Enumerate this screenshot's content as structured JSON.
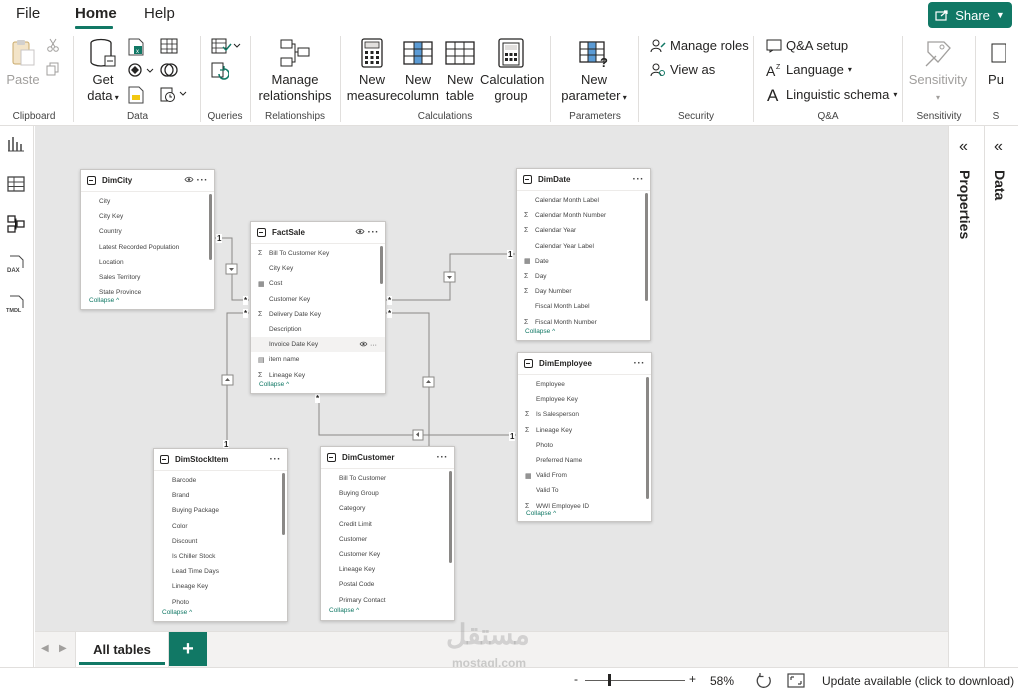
{
  "menu": {
    "file": "File",
    "home": "Home",
    "help": "Help",
    "share": "Share"
  },
  "ribbon": {
    "paste": "Paste",
    "get_data": "Get",
    "get_data2": "data",
    "manage_rel": "Manage",
    "manage_rel2": "relationships",
    "new_measure": "New",
    "new_measure2": "measure",
    "new_column": "New",
    "new_column2": "column",
    "new_table": "New",
    "new_table2": "table",
    "calc_group": "Calculation",
    "calc_group2": "group",
    "new_param": "New",
    "new_param2": "parameter",
    "manage_roles": "Manage roles",
    "view_as": "View as",
    "qa_setup": "Q&A setup",
    "language": "Language",
    "ling_schema": "Linguistic schema",
    "sensitivity": "Sensitivity",
    "publish": "Pu",
    "groups": {
      "clipboard": "Clipboard",
      "data": "Data",
      "queries": "Queries",
      "relationships": "Relationships",
      "calculations": "Calculations",
      "parameters": "Parameters",
      "security": "Security",
      "qa": "Q&A",
      "sensitivity": "Sensitivity",
      "s": "S"
    }
  },
  "tables": {
    "dimcity": {
      "title": "DimCity",
      "fields": [
        "City",
        "City Key",
        "Country",
        "Latest Recorded Population",
        "Location",
        "Sales Territory",
        "State Province"
      ],
      "collapse": "Collapse"
    },
    "factsale": {
      "title": "FactSale",
      "fields": [
        "Bill To Customer Key",
        "City Key",
        "Cost",
        "Customer Key",
        "Delivery Date Key",
        "Description",
        "Invoice Date Key",
        "item name",
        "Lineage Key"
      ],
      "collapse": "Collapse"
    },
    "dimdate": {
      "title": "DimDate",
      "fields": [
        "Calendar Month Label",
        "Calendar Month Number",
        "Calendar Year",
        "Calendar Year Label",
        "Date",
        "Day",
        "Day Number",
        "Fiscal Month Label",
        "Fiscal Month Number"
      ],
      "collapse": "Collapse"
    },
    "dimemployee": {
      "title": "DimEmployee",
      "fields": [
        "Employee",
        "Employee Key",
        "Is Salesperson",
        "Lineage Key",
        "Photo",
        "Preferred Name",
        "Valid From",
        "Valid To",
        "WWI Employee ID"
      ],
      "collapse": "Collapse"
    },
    "dimstockitem": {
      "title": "DimStockItem",
      "fields": [
        "Barcode",
        "Brand",
        "Buying Package",
        "Color",
        "Discount",
        "Is Chiller Stock",
        "Lead Time Days",
        "Lineage Key",
        "Photo"
      ],
      "collapse": "Collapse"
    },
    "dimcustomer": {
      "title": "DimCustomer",
      "fields": [
        "Bill To Customer",
        "Buying Group",
        "Category",
        "Credit Limit",
        "Customer",
        "Customer Key",
        "Lineage Key",
        "Postal Code",
        "Primary Contact"
      ],
      "collapse": "Collapse"
    }
  },
  "rel_labels": {
    "one": "1",
    "many": "*"
  },
  "panes": {
    "properties": "Properties",
    "data": "Data"
  },
  "tabs": {
    "all_tables": "All tables",
    "add": "+"
  },
  "status": {
    "minus": "-",
    "plus": "+",
    "zoom": "58%",
    "update": "Update available (click to download)"
  },
  "watermark": {
    "arabic": "مستقل",
    "latin": "mostaql.com"
  },
  "colors": {
    "accent": "#117865",
    "canvas": "#e6e6e6"
  }
}
